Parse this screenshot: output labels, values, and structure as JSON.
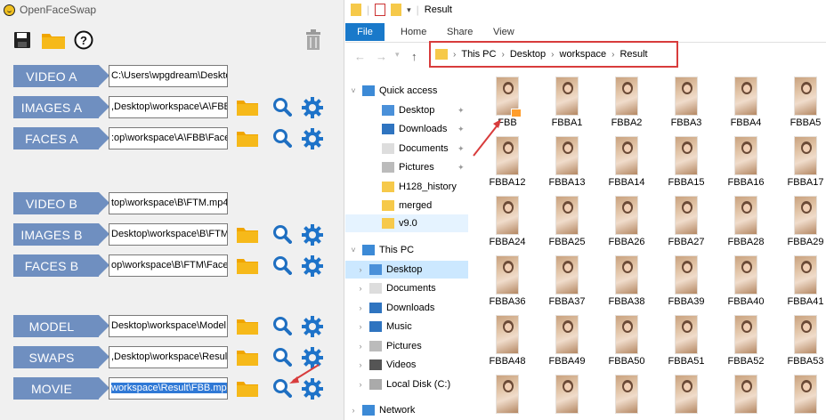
{
  "ofs": {
    "title": "OpenFaceSwap",
    "rows": [
      {
        "label": "VIDEO A",
        "value": "C:\\Users\\wpgdream\\Desktop"
      },
      {
        "label": "IMAGES A",
        "value": ",Desktop\\workspace\\A\\FBB"
      },
      {
        "label": "FACES A",
        "value": ":op\\workspace\\A\\FBB\\Face"
      },
      {
        "label": "VIDEO B",
        "value": "top\\workspace\\B\\FTM.mp4"
      },
      {
        "label": "IMAGES B",
        "value": "Desktop\\workspace\\B\\FTM"
      },
      {
        "label": "FACES B",
        "value": "op\\workspace\\B\\FTM\\Face"
      },
      {
        "label": "MODEL",
        "value": "Desktop\\workspace\\Model"
      },
      {
        "label": "SWAPS",
        "value": ",Desktop\\workspace\\Result"
      },
      {
        "label": "MOVIE",
        "value": "workspace\\Result\\FBB.mp4"
      }
    ]
  },
  "explorer": {
    "title": "Result",
    "tabs": [
      "File",
      "Home",
      "Share",
      "View"
    ],
    "address": [
      "This PC",
      "Desktop",
      "workspace",
      "Result"
    ],
    "tree": [
      "Quick access",
      "Desktop",
      "Downloads",
      "Documents",
      "Pictures",
      "H128_history",
      "merged",
      "v9.0",
      "This PC",
      "Desktop",
      "Documents",
      "Downloads",
      "Music",
      "Pictures",
      "Videos",
      "Local Disk (C:)",
      "Network"
    ],
    "files": [
      "FBB",
      "FBBA1",
      "FBBA2",
      "FBBA3",
      "FBBA4",
      "FBBA5",
      "FBBA12",
      "FBBA13",
      "FBBA14",
      "FBBA15",
      "FBBA16",
      "FBBA17",
      "FBBA24",
      "FBBA25",
      "FBBA26",
      "FBBA27",
      "FBBA28",
      "FBBA29",
      "FBBA36",
      "FBBA37",
      "FBBA38",
      "FBBA39",
      "FBBA40",
      "FBBA41",
      "FBBA48",
      "FBBA49",
      "FBBA50",
      "FBBA51",
      "FBBA52",
      "FBBA53",
      "",
      "",
      "",
      "",
      "",
      ""
    ]
  },
  "colors": {
    "label_bg": "#6f8fc0",
    "folder": "#f4b400",
    "search": "#1f6fc1",
    "gear": "#1e73c9",
    "annotation": "#d83c3c"
  }
}
